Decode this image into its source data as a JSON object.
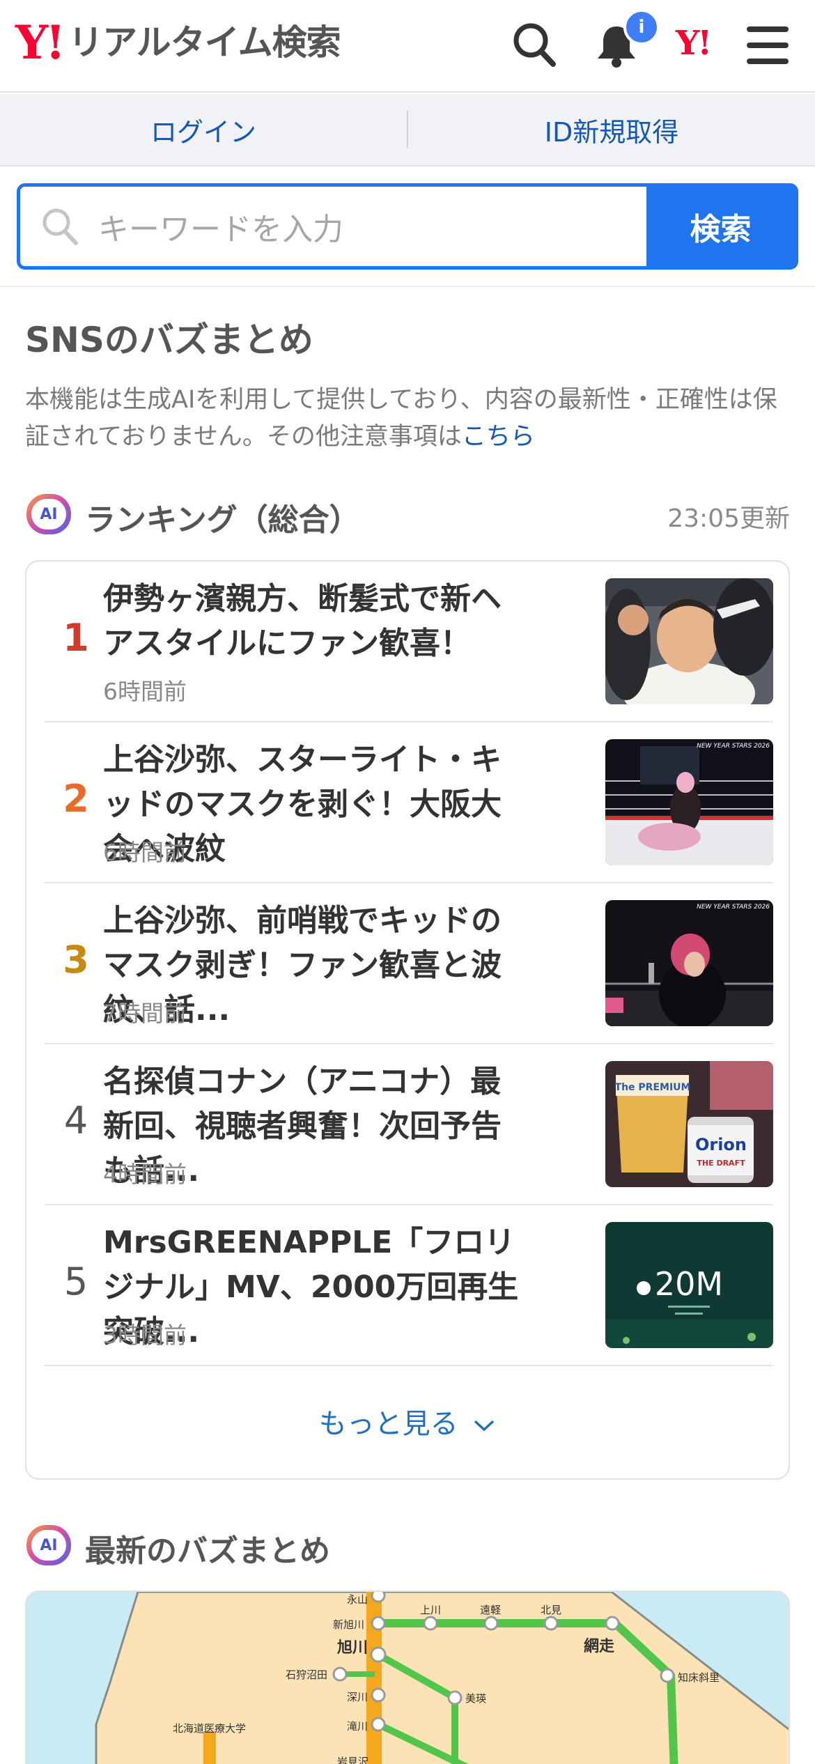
{
  "header": {
    "logo_mark": "Y!",
    "logo_text": "リアルタイム検索",
    "notification_badge": "i",
    "yahoo_mark": "Y!"
  },
  "auth": {
    "login_label": "ログイン",
    "signup_label": "ID新規取得"
  },
  "search": {
    "placeholder": "キーワードを入力",
    "button_label": "検索"
  },
  "section": {
    "title": "SNSのバズまとめ",
    "notice": "本機能は生成AIを利用して提供しており、内容の最新性・正確性は保証されておりません。その他注意事項は",
    "notice_link": "こちら"
  },
  "ranking": {
    "ai_badge": "AI",
    "heading": "ランキング（総合）",
    "updated": "23:05更新",
    "items": [
      {
        "rank": "1",
        "title": "伊勢ヶ濱親方、断髪式で新ヘアスタイルにファン歓喜！",
        "time": "6時間前"
      },
      {
        "rank": "2",
        "title": "上谷沙弥、スターライト・キッドのマスクを剥ぐ！大阪大会へ波紋",
        "time": "6時間前"
      },
      {
        "rank": "3",
        "title": "上谷沙弥、前哨戦でキッドのマスク剥ぎ！ファン歓喜と波紋、話...",
        "time": "7時間前"
      },
      {
        "rank": "4",
        "title": "名探偵コナン（アニコナ）最新回、視聴者興奮！次回予告も話...",
        "time": "4時間前"
      },
      {
        "rank": "5",
        "title": "MrsGREENAPPLE「フロリジナル」MV、2000万回再生突破...",
        "time": "3時間前"
      }
    ],
    "thumb_texts": {
      "t2": "NEW YEAR STARS 2026",
      "t3": "NEW YEAR STARS 2026",
      "t4_a": "The PREMIUM",
      "t4_b": "Orion",
      "t4_c": "THE DRAFT",
      "t5": "20M"
    },
    "more_label": "もっと見る"
  },
  "latest": {
    "ai_badge": "AI",
    "heading": "最新のバズまとめ",
    "map_labels": {
      "a": "永山",
      "b": "上川",
      "c": "遠軽",
      "d": "北見",
      "e": "新旭川",
      "f": "旭川",
      "g": "網走",
      "h": "石狩沼田",
      "i": "深川",
      "j": "美瑛",
      "k": "知床斜里",
      "l": "北海道医療大学",
      "m": "滝川",
      "n": "岩見沢"
    }
  },
  "colors": {
    "brand_red": "#ff0033",
    "accent_blue": "#1f74f0",
    "link_blue": "#1558b5",
    "rank1": "#d33a2c",
    "rank2": "#ea6a2a",
    "rank3": "#c68a12"
  }
}
